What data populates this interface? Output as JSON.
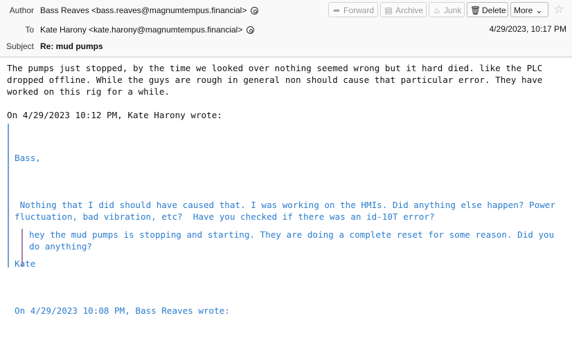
{
  "header": {
    "author_label": "Author",
    "author_value": "Bass Reaves <bass.reaves@magnumtempus.financial>",
    "to_label": "To",
    "to_value": "Kate Harony <kate.harony@magnumtempus.financial>",
    "subject_label": "Subject",
    "subject_value": "Re: mud pumps",
    "date": "4/29/2023, 10:17 PM"
  },
  "toolbar": {
    "forward_label": "Forward",
    "archive_label": "Archive",
    "junk_label": "Junk",
    "delete_label": "Delete",
    "more_label": "More"
  },
  "message": {
    "reply_text": "The pumps just stopped, by the time we looked over nothing seemed wrong but it hard died. like the PLC dropped offline. While the guys are rough in general non should cause that particular error. They have worked on this rig for a while.",
    "attribution_1": "On 4/29/2023 10:12 PM, Kate Harony wrote:",
    "quote1_greeting": "Bass,",
    "quote1_body": " Nothing that I did should have caused that. I was working on the HMIs. Did anything else happen? Power fluctuation, bad vibration, etc?  Have you checked if there was an id-10T error?",
    "quote1_signoff": "Kate",
    "attribution_2": "On 4/29/2023 10:08 PM, Bass Reaves wrote:",
    "quote2_body": "hey the mud pumps is stopping and starting. They are doing a complete reset for some reason. Did you do anything?"
  },
  "icons": {
    "forward": "forward-arrow-icon",
    "archive": "archive-box-icon",
    "junk": "flame-icon",
    "delete": "trash-icon",
    "more": "chevron-down-icon",
    "star": "star-icon",
    "contact": "contact-icon"
  }
}
